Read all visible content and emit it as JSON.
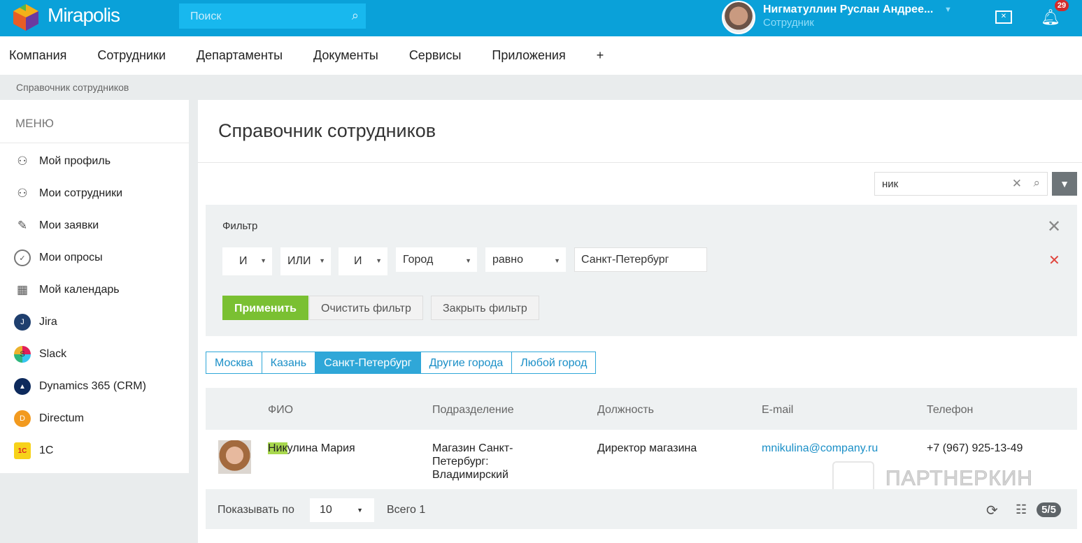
{
  "header": {
    "logo": "Mirapolis",
    "search_placeholder": "Поиск",
    "user_name": "Нигматуллин Руслан Андрее...",
    "user_role": "Сотрудник",
    "notifications": "29"
  },
  "nav": [
    "Компания",
    "Сотрудники",
    "Департаменты",
    "Документы",
    "Сервисы",
    "Приложения",
    "+"
  ],
  "breadcrumb": "Справочник сотрудников",
  "sidebar": {
    "heading": "МЕНЮ",
    "items": [
      {
        "label": "Мой профиль",
        "icon": "user-icon"
      },
      {
        "label": "Мои сотрудники",
        "icon": "users-icon"
      },
      {
        "label": "Мои заявки",
        "icon": "pencil-icon"
      },
      {
        "label": "Мои опросы",
        "icon": "check-circle-icon"
      },
      {
        "label": "Мой календарь",
        "icon": "calendar-icon"
      },
      {
        "label": "Jira",
        "icon": "jira-icon"
      },
      {
        "label": "Slack",
        "icon": "slack-icon"
      },
      {
        "label": "Dynamics 365 (CRM)",
        "icon": "dynamics-icon"
      },
      {
        "label": "Directum",
        "icon": "directum-icon"
      },
      {
        "label": "1С",
        "icon": "1c-icon"
      }
    ]
  },
  "page": {
    "title": "Справочник сотрудников",
    "search_value": "ник"
  },
  "filter": {
    "title": "Фильтр",
    "ops": [
      "И",
      "ИЛИ",
      "И"
    ],
    "field": "Город",
    "condition": "равно",
    "value": "Санкт-Петербург",
    "apply": "Применить",
    "clear": "Очистить фильтр",
    "close": "Закрыть фильтр"
  },
  "tabs": [
    "Москва",
    "Казань",
    "Санкт-Петербург",
    "Другие города",
    "Любой город"
  ],
  "table": {
    "columns": [
      "ФИО",
      "Подразделение",
      "Должность",
      "E-mail",
      "Телефон"
    ],
    "rows": [
      {
        "name_hl": "Ник",
        "name_rest": "улина Мария",
        "dept": "Магазин Санкт-Петербург: Владимирский",
        "position": "Директор магазина",
        "email": "mnikulina@company.ru",
        "phone": "+7 (967) 925-13-49"
      }
    ]
  },
  "footer": {
    "show_label": "Показывать по",
    "page_size": "10",
    "total": "Всего 1",
    "pages": "5/5"
  },
  "watermark": "ПАРТНЕРКИН"
}
